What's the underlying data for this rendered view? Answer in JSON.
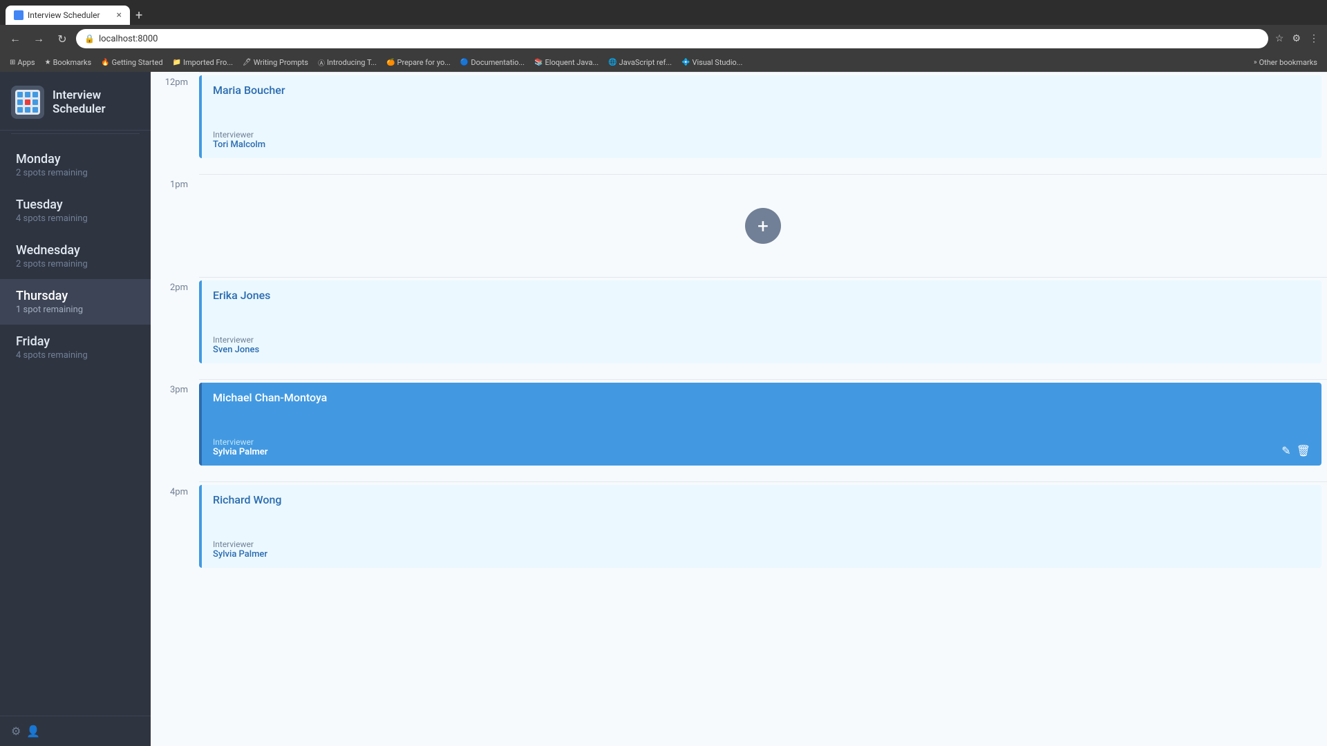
{
  "browser": {
    "tab_title": "Interview Scheduler",
    "url": "localhost:8000",
    "bookmarks": [
      {
        "label": "Apps",
        "icon": "⊞"
      },
      {
        "label": "Bookmarks",
        "icon": "★"
      },
      {
        "label": "Getting Started",
        "icon": "🔥"
      },
      {
        "label": "Imported Fro...",
        "icon": "📁"
      },
      {
        "label": "Writing Prompts",
        "icon": "🖊"
      },
      {
        "label": "Introducing T...",
        "icon": "Ⓐ"
      },
      {
        "label": "Prepare for yo...",
        "icon": "🍊"
      },
      {
        "label": "Documentatio...",
        "icon": "🔵"
      },
      {
        "label": "Eloquent Java...",
        "icon": "📚"
      },
      {
        "label": "JavaScript ref...",
        "icon": "🌐"
      },
      {
        "label": "Visual Studio...",
        "icon": "💠"
      },
      {
        "label": "Other bookmarks",
        "icon": "📁"
      }
    ]
  },
  "app": {
    "title_line1": "Interview",
    "title_line2": "Scheduler"
  },
  "sidebar": {
    "days": [
      {
        "name": "Monday",
        "spots": "2 spots remaining",
        "active": false
      },
      {
        "name": "Tuesday",
        "spots": "4 spots remaining",
        "active": false
      },
      {
        "name": "Wednesday",
        "spots": "2 spots remaining",
        "active": false
      },
      {
        "name": "Thursday",
        "spots": "1 spot remaining",
        "active": true
      },
      {
        "name": "Friday",
        "spots": "4 spots remaining",
        "active": false
      }
    ]
  },
  "schedule": {
    "time_slots": [
      {
        "time": "12pm",
        "cards": [
          {
            "candidate": "Maria Boucher",
            "interviewer_label": "Interviewer",
            "interviewer": "Tori Malcolm",
            "type": "light",
            "active": false
          }
        ]
      },
      {
        "time": "1pm",
        "cards": []
      },
      {
        "time": "2pm",
        "cards": [
          {
            "candidate": "Erika Jones",
            "interviewer_label": "Interviewer",
            "interviewer": "Sven Jones",
            "type": "light",
            "active": false
          }
        ]
      },
      {
        "time": "3pm",
        "cards": [
          {
            "candidate": "Michael Chan-Montoya",
            "interviewer_label": "Interviewer",
            "interviewer": "Sylvia Palmer",
            "type": "active",
            "active": true
          }
        ]
      },
      {
        "time": "4pm",
        "cards": [
          {
            "candidate": "Richard Wong",
            "interviewer_label": "Interviewer",
            "interviewer": "Sylvia Palmer",
            "type": "light",
            "active": false
          }
        ]
      }
    ]
  },
  "icons": {
    "back": "←",
    "forward": "→",
    "refresh": "↻",
    "lock": "🔒",
    "star": "☆",
    "plus": "+",
    "edit": "✎",
    "delete": "🗑",
    "settings": "⚙"
  }
}
